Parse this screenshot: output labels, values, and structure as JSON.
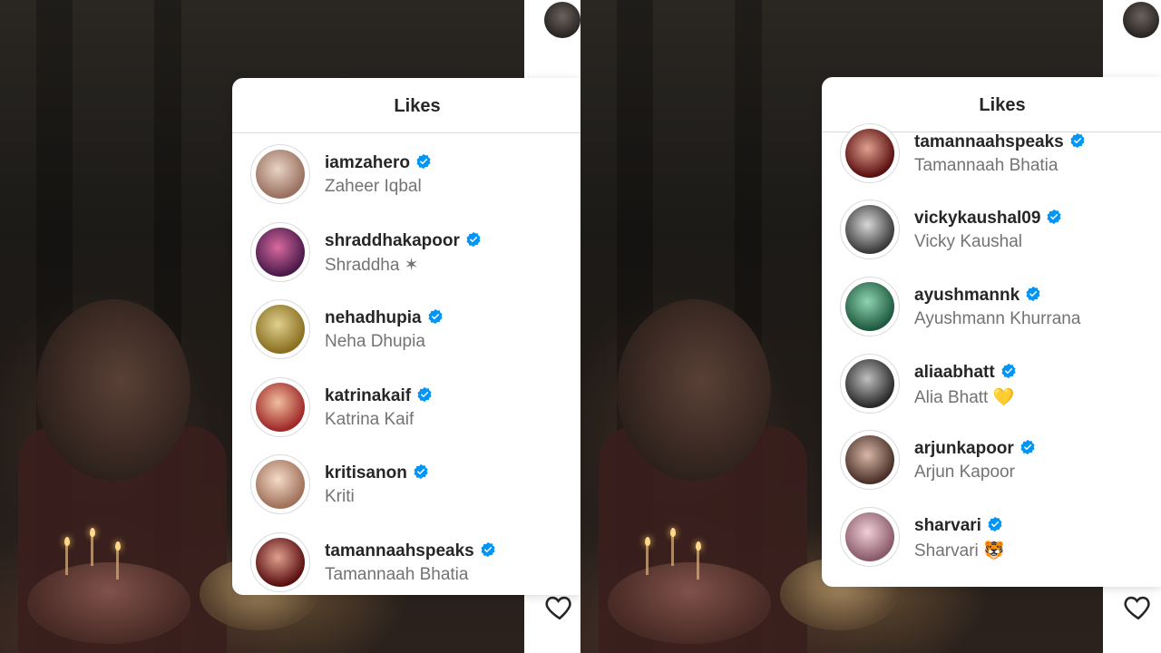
{
  "modal_title": "Likes",
  "left_panel": {
    "users": [
      {
        "username": "iamzahero",
        "fullname": "Zaheer Iqbal",
        "avatar_color": "#c9a99a"
      },
      {
        "username": "shraddhakapoor",
        "fullname": "Shraddha ✶",
        "avatar_color": "#8a3a6a"
      },
      {
        "username": "nehadhupia",
        "fullname": "Neha Dhupia",
        "avatar_color": "#b59a3a"
      },
      {
        "username": "katrinakaif",
        "fullname": "Katrina Kaif",
        "avatar_color": "#b23a3a"
      },
      {
        "username": "kritisanon",
        "fullname": "Kriti",
        "avatar_color": "#d8b7a5"
      },
      {
        "username": "tamannaahspeaks",
        "fullname": "Tamannaah Bhatia",
        "avatar_color": "#7a1f1f"
      }
    ]
  },
  "right_panel": {
    "users": [
      {
        "username": "tamannaahspeaks",
        "fullname": "Tamannaah Bhatia",
        "avatar_color": "#7a1f1f"
      },
      {
        "username": "vickykaushal09",
        "fullname": "Vicky Kaushal",
        "avatar_color": "#8e8e8e"
      },
      {
        "username": "ayushmannk",
        "fullname": "Ayushmann Khurrana",
        "avatar_color": "#3a7a5a"
      },
      {
        "username": "aliaabhatt",
        "fullname": "Alia Bhatt 💛",
        "avatar_color": "#6a6a6a"
      },
      {
        "username": "arjunkapoor",
        "fullname": "Arjun Kapoor",
        "avatar_color": "#8a6a5a"
      },
      {
        "username": "sharvari",
        "fullname": "Sharvari 🐯",
        "avatar_color": "#c8a0b0"
      }
    ]
  },
  "colors": {
    "verified": "#0095f6",
    "username": "#262626",
    "fullname": "#737373"
  },
  "icons": {
    "verified": "verified-badge-icon",
    "like": "heart-icon"
  }
}
